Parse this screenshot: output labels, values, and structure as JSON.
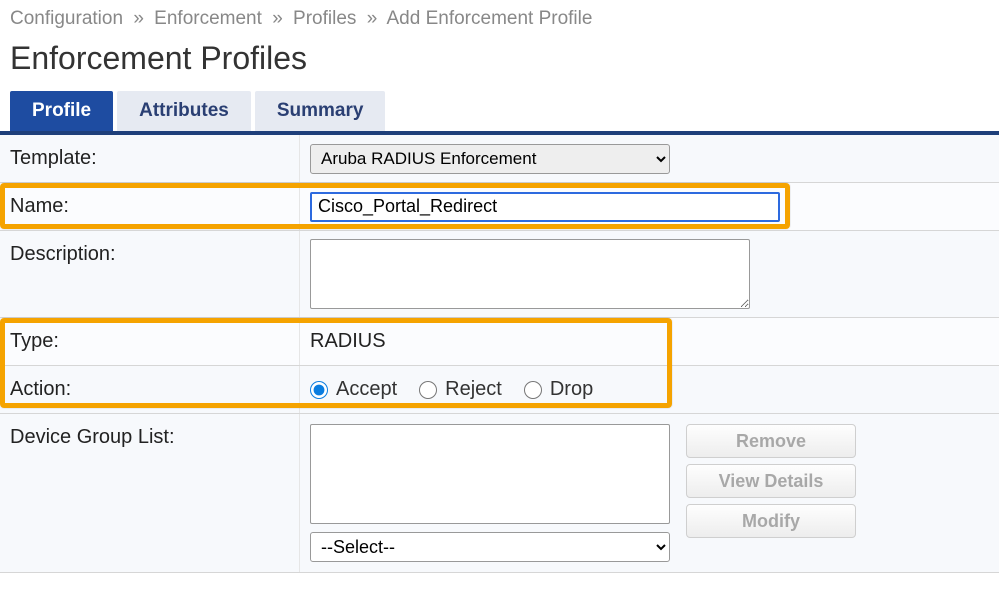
{
  "breadcrumb": {
    "items": [
      "Configuration",
      "Enforcement",
      "Profiles",
      "Add Enforcement Profile"
    ]
  },
  "page_title": "Enforcement Profiles",
  "tabs": {
    "profile": "Profile",
    "attributes": "Attributes",
    "summary": "Summary"
  },
  "form": {
    "template": {
      "label": "Template:",
      "value": "Aruba RADIUS Enforcement"
    },
    "name": {
      "label": "Name:",
      "value": "Cisco_Portal_Redirect"
    },
    "description": {
      "label": "Description:",
      "value": ""
    },
    "type": {
      "label": "Type:",
      "value": "RADIUS"
    },
    "action": {
      "label": "Action:",
      "options": {
        "accept": "Accept",
        "reject": "Reject",
        "drop": "Drop"
      },
      "selected": "accept"
    },
    "device_group_list": {
      "label": "Device Group List:",
      "select_placeholder": "--Select--",
      "buttons": {
        "remove": "Remove",
        "view_details": "View Details",
        "modify": "Modify"
      }
    }
  }
}
